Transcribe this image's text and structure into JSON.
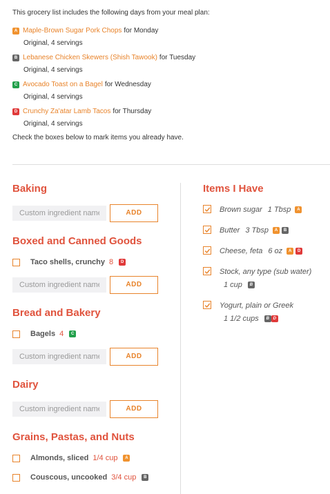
{
  "intro": {
    "text": "This grocery list includes the following days from your meal plan:",
    "days": [
      {
        "badge": "A",
        "recipe": "Maple-Brown Sugar Pork Chops",
        "for_text": "for Monday",
        "servings": "Original, 4 servings"
      },
      {
        "badge": "B",
        "recipe": "Lebanese Chicken Skewers (Shish Tawook)",
        "for_text": "for Tuesday",
        "servings": "Original, 4 servings"
      },
      {
        "badge": "C",
        "recipe": "Avocado Toast on a Bagel",
        "for_text": "for Wednesday",
        "servings": "Original, 4 servings"
      },
      {
        "badge": "D",
        "recipe": "Crunchy Za'atar Lamb Tacos",
        "for_text": "for Thursday",
        "servings": "Original, 4 servings"
      }
    ],
    "check_text": "Check the boxes below to mark items you already have."
  },
  "badge_colors": {
    "A": "#f0922f",
    "B": "#666666",
    "C": "#22a04b",
    "D": "#e03a3a"
  },
  "sections": [
    {
      "title": "Baking",
      "items": [],
      "placeholder": "Custom ingredient name",
      "add_label": "ADD"
    },
    {
      "title": "Boxed and Canned Goods",
      "items": [
        {
          "name": "Taco shells, crunchy",
          "qty": "8",
          "badges": [
            "D"
          ]
        }
      ],
      "placeholder": "Custom ingredient name",
      "add_label": "ADD"
    },
    {
      "title": "Bread and Bakery",
      "items": [
        {
          "name": "Bagels",
          "qty": "4",
          "badges": [
            "C"
          ]
        }
      ],
      "placeholder": "Custom ingredient name",
      "add_label": "ADD"
    },
    {
      "title": "Dairy",
      "items": [],
      "placeholder": "Custom ingredient name",
      "add_label": "ADD"
    },
    {
      "title": "Grains, Pastas, and Nuts",
      "items": [
        {
          "name": "Almonds, sliced",
          "qty": "1/4 cup",
          "badges": [
            "A"
          ]
        },
        {
          "name": "Couscous, uncooked",
          "qty": "3/4 cup",
          "badges": [
            "B"
          ]
        }
      ]
    }
  ],
  "have": {
    "title": "Items I Have",
    "items": [
      {
        "name": "Brown sugar",
        "qty": "1 Tbsp",
        "badges": [
          "A"
        ],
        "wrap": false,
        "checked": true
      },
      {
        "name": "Butter",
        "qty": "3 Tbsp",
        "badges": [
          "A",
          "B"
        ],
        "wrap": false,
        "checked": true
      },
      {
        "name": "Cheese, feta",
        "qty": "6 oz",
        "badges": [
          "A",
          "D"
        ],
        "wrap": false,
        "checked": true
      },
      {
        "name": "Stock, any type (sub water)",
        "qty": "1 cup",
        "badges": [
          "B"
        ],
        "wrap": true,
        "checked": true
      },
      {
        "name": "Yogurt, plain or Greek",
        "qty": "1 1/2 cups",
        "badges": [
          "B",
          "D"
        ],
        "wrap": true,
        "checked": true
      }
    ]
  }
}
